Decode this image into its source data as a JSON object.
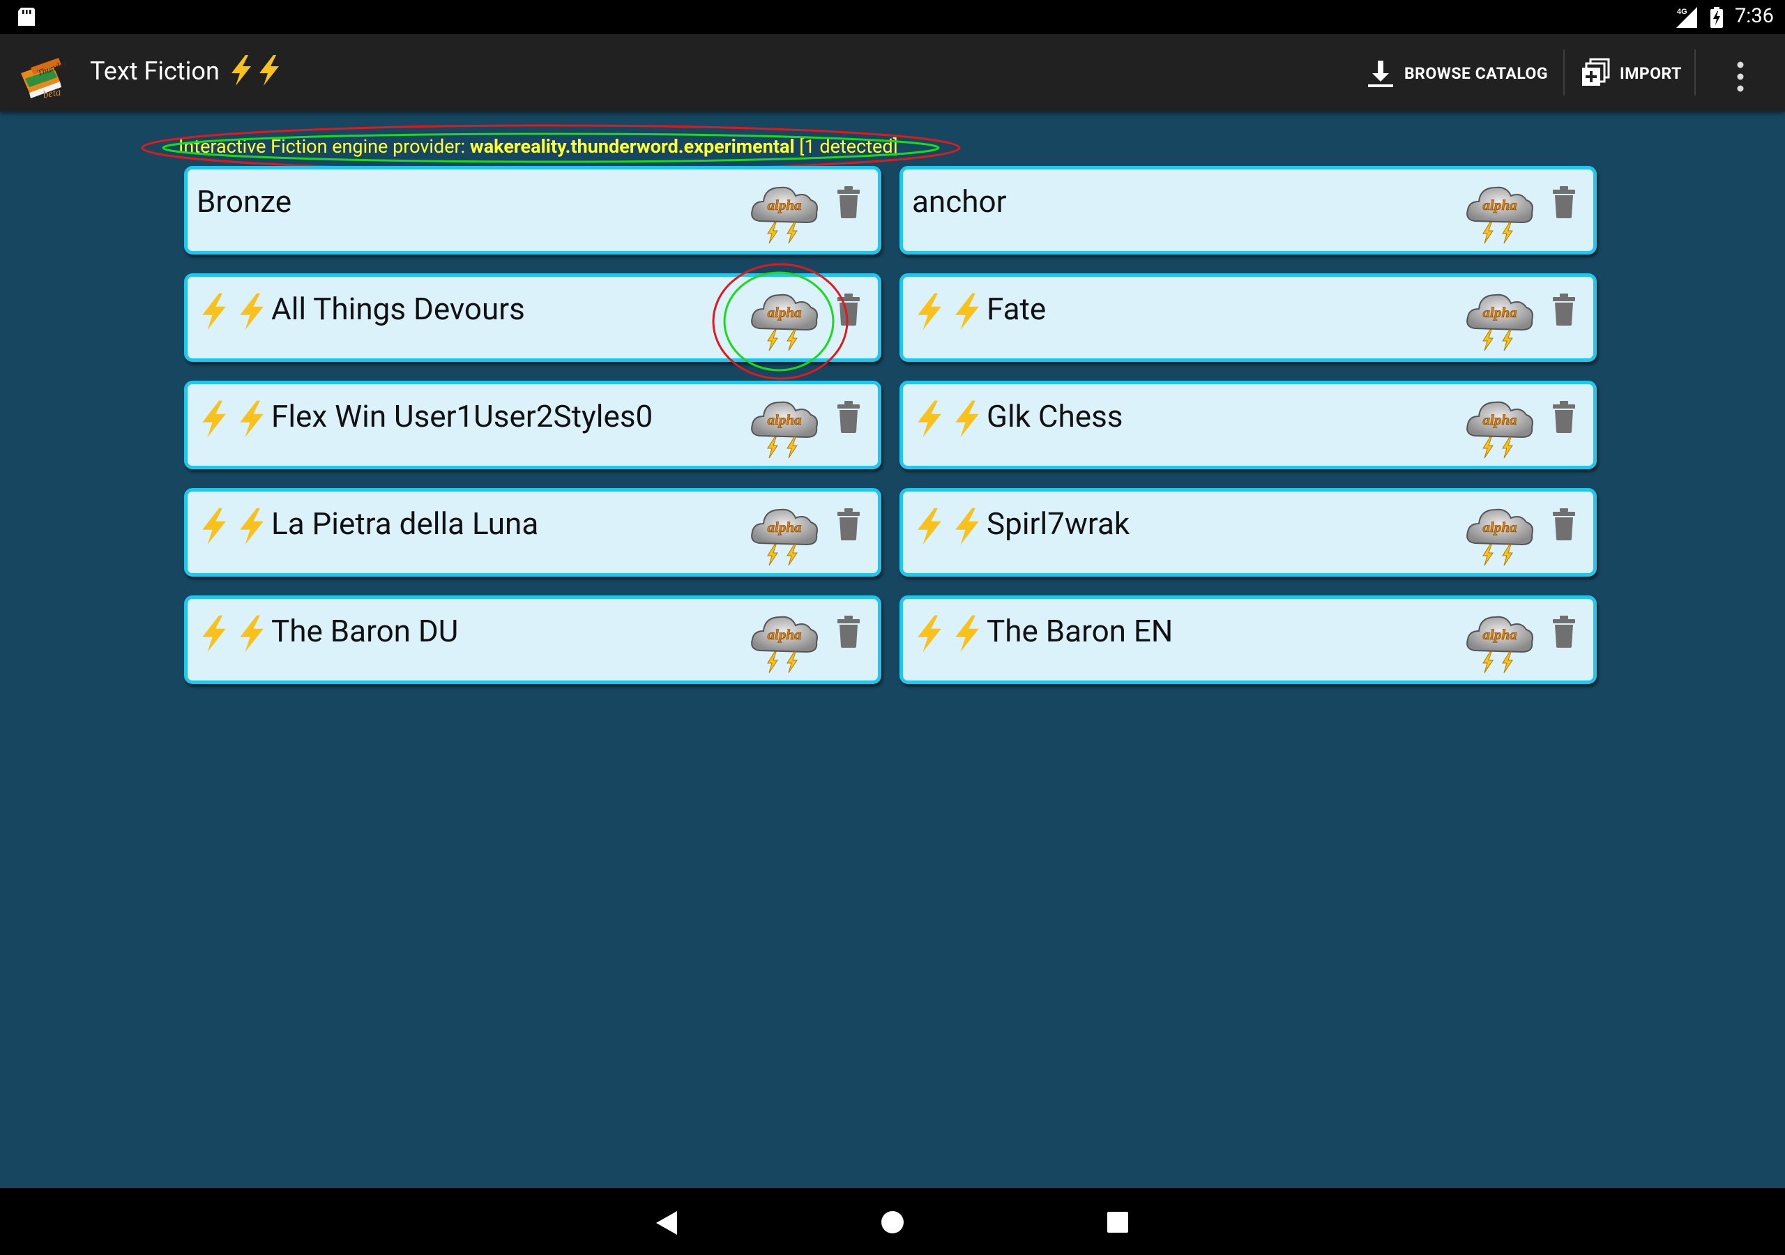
{
  "status_bar": {
    "network": "4G",
    "time": "7:36"
  },
  "app_bar": {
    "title": "Text Fiction",
    "title_bolts": [
      "⚡",
      "⚡"
    ],
    "actions": {
      "browse_catalog": "BROWSE CATALOG",
      "import": "IMPORT"
    }
  },
  "provider": {
    "label": "Interactive Fiction engine provider: ",
    "name": "wakereality.thunderword.experimental",
    "suffix": " [1 detected]"
  },
  "stories": [
    {
      "title": "Bronze",
      "bolts": false
    },
    {
      "title": "anchor",
      "bolts": false
    },
    {
      "title": "All Things Devours",
      "bolts": true,
      "highlighted_engine": true
    },
    {
      "title": "Fate",
      "bolts": true
    },
    {
      "title": "Flex Win User1User2Styles0",
      "bolts": true
    },
    {
      "title": "Glk Chess",
      "bolts": true
    },
    {
      "title": "La Pietra della Luna",
      "bolts": true
    },
    {
      "title": "Spirl7wrak",
      "bolts": true
    },
    {
      "title": "The Baron DU",
      "bolts": true
    },
    {
      "title": "The Baron EN",
      "bolts": true
    }
  ],
  "engine_badge_text": "alpha",
  "colors": {
    "background": "#174760",
    "card_fill": "#dcf2fb",
    "card_border": "#20c6ed",
    "provider_text": "#ffff33",
    "bolt": "#f7c21e",
    "ring_outer": "#e0191c",
    "ring_inner": "#1ed81e"
  }
}
